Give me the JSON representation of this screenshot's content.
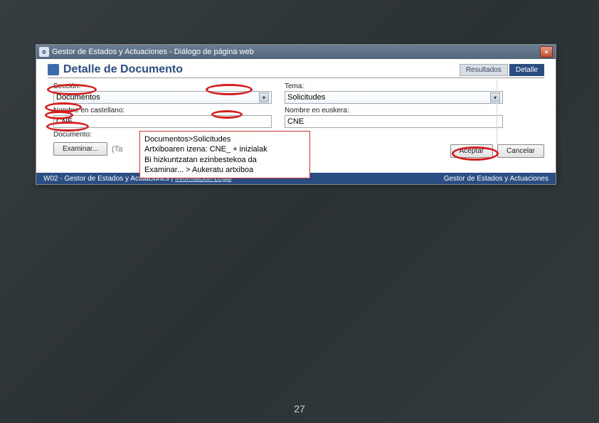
{
  "window": {
    "title": "Gestor de Estados y Actuaciones - Diálogo de página web",
    "close_label": "×"
  },
  "header": {
    "title": "Detalle de Documento",
    "tabs": {
      "resultados": "Resultados",
      "detalle": "Detalle"
    }
  },
  "fields": {
    "seccion": {
      "label": "Sección:",
      "value": "Documentos"
    },
    "tema": {
      "label": "Tema:",
      "value": "Solicitudes"
    },
    "nombre_cast": {
      "label": "Nombre en castellano:",
      "value": "CNE"
    },
    "nombre_eusk": {
      "label": "Nombre en euskera:",
      "value": "CNE"
    },
    "documento": {
      "label": "Documento:"
    }
  },
  "buttons": {
    "examinar": "Examinar...",
    "aceptar": "Aceptar",
    "cancelar": "Cancelar"
  },
  "examinar_hint": "(Ta",
  "footer": {
    "left_app": "W02 - Gestor de Estados y Actuaciones",
    "left_sep": " | ",
    "left_link": "Información Legal",
    "right": "Gestor de Estados y Actuaciones"
  },
  "annotation": {
    "l1": "Documentos>Solicitudes",
    "l2": "Artxiboaren izena: CNE_ + inizialak",
    "l3": "Bi hizkuntzatan ezinbestekoa da",
    "l4": "Examinar... > Aukeratu artxiboa"
  },
  "page_number": "27"
}
